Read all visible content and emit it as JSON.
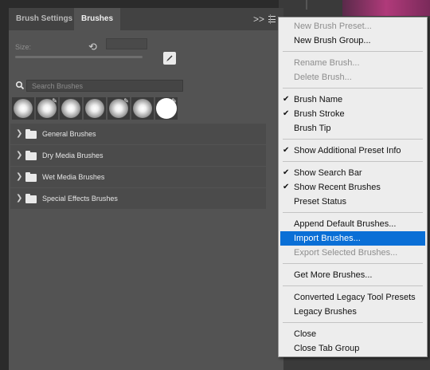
{
  "panel": {
    "tabs": [
      {
        "label": "Brush Settings",
        "active": false
      },
      {
        "label": "Brushes",
        "active": true
      }
    ],
    "collapse_glyph": ">>",
    "size_label": "Size:",
    "search": {
      "placeholder": "Search Brushes",
      "value": ""
    },
    "groups": [
      {
        "label": "General Brushes"
      },
      {
        "label": "Dry Media Brushes"
      },
      {
        "label": "Wet Media Brushes"
      },
      {
        "label": "Special Effects Brushes"
      }
    ]
  },
  "menu": {
    "items": [
      {
        "label": "New Brush Preset...",
        "enabled": false,
        "checked": false
      },
      {
        "label": "New Brush Group...",
        "enabled": true,
        "checked": false
      },
      {
        "label": "Rename Brush...",
        "enabled": false,
        "checked": false
      },
      {
        "label": "Delete Brush...",
        "enabled": false,
        "checked": false
      },
      {
        "label": "Brush Name",
        "enabled": true,
        "checked": true
      },
      {
        "label": "Brush Stroke",
        "enabled": true,
        "checked": true
      },
      {
        "label": "Brush Tip",
        "enabled": true,
        "checked": false
      },
      {
        "label": "Show Additional Preset Info",
        "enabled": true,
        "checked": true
      },
      {
        "label": "Show Search Bar",
        "enabled": true,
        "checked": true
      },
      {
        "label": "Show Recent Brushes",
        "enabled": true,
        "checked": true
      },
      {
        "label": "Preset Status",
        "enabled": true,
        "checked": false
      },
      {
        "label": "Append Default Brushes...",
        "enabled": true,
        "checked": false
      },
      {
        "label": "Import Brushes...",
        "enabled": true,
        "checked": false,
        "highlighted": true
      },
      {
        "label": "Export Selected Brushes...",
        "enabled": false,
        "checked": false
      },
      {
        "label": "Get More Brushes...",
        "enabled": true,
        "checked": false
      },
      {
        "label": "Converted Legacy Tool Presets",
        "enabled": true,
        "checked": false
      },
      {
        "label": "Legacy Brushes",
        "enabled": true,
        "checked": false
      },
      {
        "label": "Close",
        "enabled": true,
        "checked": false
      },
      {
        "label": "Close Tab Group",
        "enabled": true,
        "checked": false
      }
    ],
    "check_glyph": "✔"
  },
  "colors": {
    "highlight": "#0a6fd6",
    "menu_bg": "#ededed",
    "panel_bg": "#535353"
  }
}
